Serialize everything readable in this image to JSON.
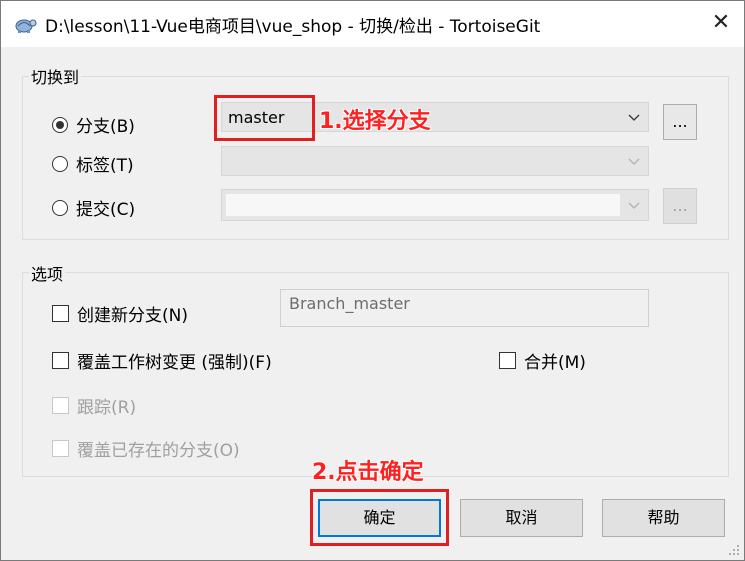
{
  "window": {
    "title": "D:\\lesson\\11-Vue电商项目\\vue_shop - 切换/检出 - TortoiseGit",
    "icon": "tortoise-icon",
    "close_glyph": "✕"
  },
  "switch_to": {
    "label": "切换到",
    "branch": {
      "label": "分支(B)",
      "checked": true,
      "value": "master"
    },
    "tag": {
      "label": "标签(T)",
      "checked": false,
      "value": ""
    },
    "commit": {
      "label": "提交(C)",
      "checked": false,
      "value": ""
    },
    "browse_label": "..."
  },
  "options": {
    "label": "选项",
    "create_branch": {
      "label": "创建新分支(N)",
      "checked": false
    },
    "new_branch_name": "Branch_master",
    "force_overwrite": {
      "label": "覆盖工作树变更 (强制)(F)",
      "checked": false
    },
    "merge": {
      "label": "合并(M)",
      "checked": false
    },
    "track": {
      "label": "跟踪(R)",
      "checked": false,
      "enabled": false
    },
    "override_branch": {
      "label": "覆盖已存在的分支(O)",
      "checked": false,
      "enabled": false
    }
  },
  "buttons": {
    "ok": "确定",
    "cancel": "取消",
    "help": "帮助"
  },
  "annotations": {
    "step1": "1.选择分支",
    "step2": "2.点击确定",
    "color": "#ff2020"
  }
}
